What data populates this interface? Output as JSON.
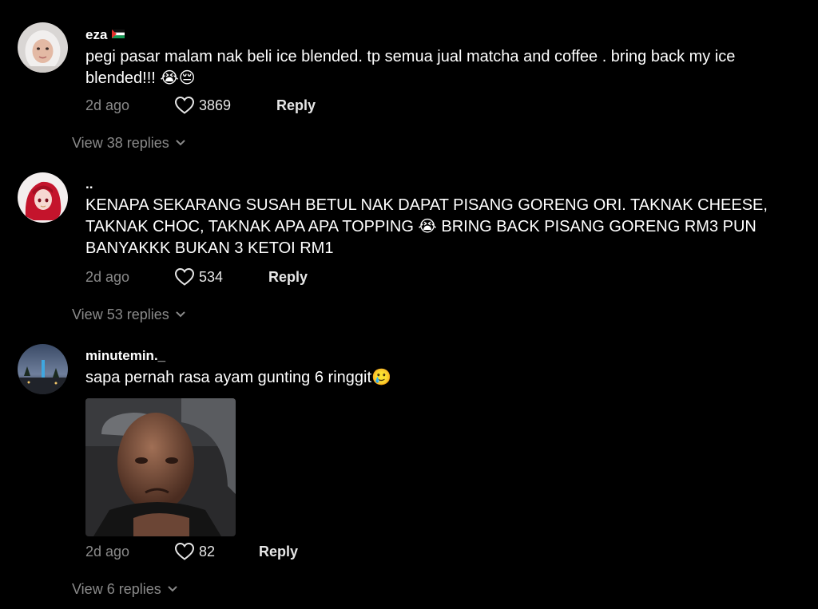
{
  "comments": [
    {
      "username": "eza",
      "text": "pegi pasar malam nak beli ice blended. tp semua jual matcha and coffee . bring back my ice blended!!! 😭😔",
      "time": "2d ago",
      "likes": "3869",
      "reply_label": "Reply",
      "view_replies": "View 38 replies"
    },
    {
      "username": "..",
      "text": "KENAPA SEKARANG SUSAH BETUL NAK DAPAT PISANG GORENG ORI. TAKNAK CHEESE, TAKNAK CHOC, TAKNAK APA APA TOPPING 😭 BRING BACK PISANG GORENG RM3 PUN BANYAKKK BUKAN 3 KETOI RM1",
      "time": "2d ago",
      "likes": "534",
      "reply_label": "Reply",
      "view_replies": "View 53 replies"
    },
    {
      "username": "minutemin._",
      "text": "sapa pernah rasa ayam gunting 6 ringgit🥲",
      "time": "2d ago",
      "likes": "82",
      "reply_label": "Reply",
      "view_replies": "View 6 replies"
    }
  ],
  "colors": {
    "background": "#000000",
    "primary_text": "#ffffff",
    "secondary_text": "#8a8a8a"
  }
}
